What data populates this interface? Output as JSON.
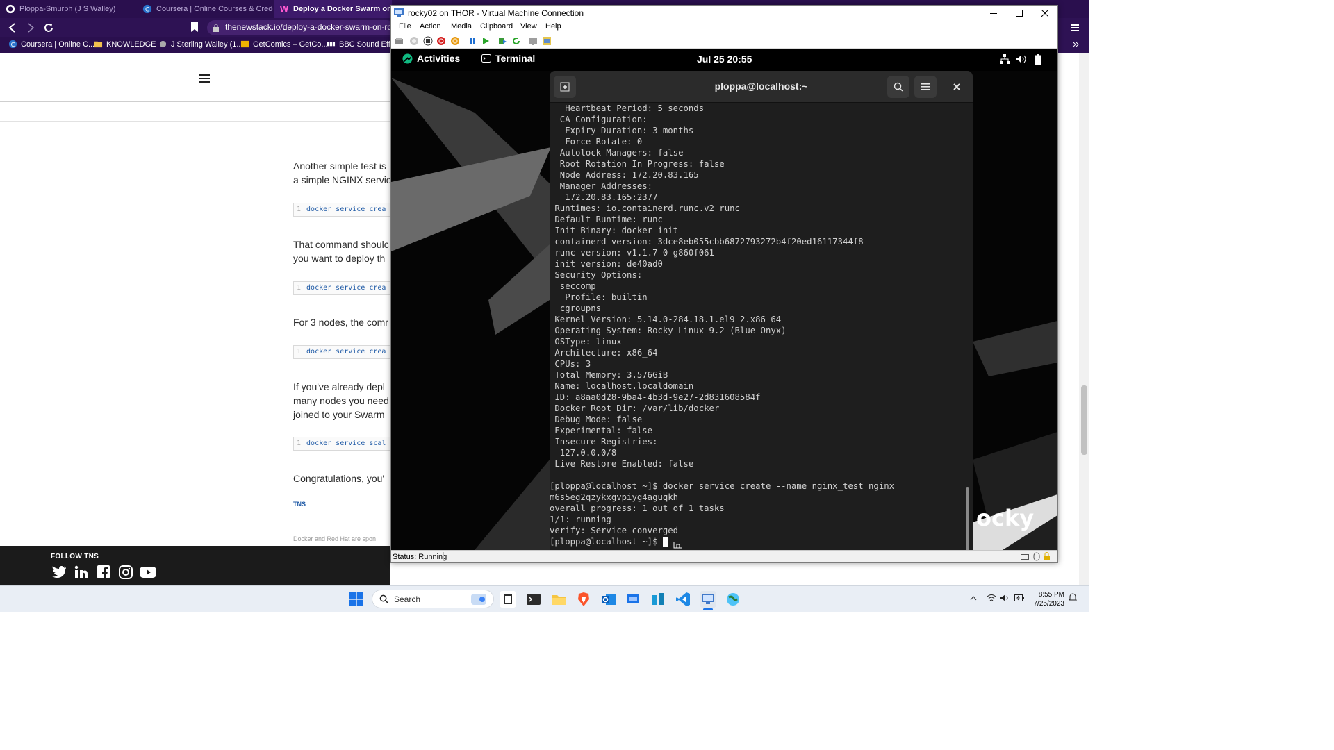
{
  "browser": {
    "tabs": [
      {
        "label": "Ploppa-Smurph (J S Walley)",
        "icon": "github-icon",
        "active": false
      },
      {
        "label": "Coursera | Online Courses & Credentia",
        "icon": "coursera-icon",
        "active": false
      },
      {
        "label": "Deploy a Docker Swarm on Roc",
        "icon": "tns-icon",
        "active": true
      }
    ],
    "url": "thenewstack.io/deploy-a-docker-swarm-on-roc",
    "bookmarks": [
      {
        "label": "Coursera | Online C...",
        "icon": "coursera-icon"
      },
      {
        "label": "KNOWLEDGE",
        "icon": "folder-icon"
      },
      {
        "label": "J Sterling Walley (1...",
        "icon": "bookmark-icon"
      },
      {
        "label": "GetComics – GetCo...",
        "icon": "comics-icon"
      },
      {
        "label": "BBC Sound Effec",
        "icon": "bbc-icon"
      }
    ]
  },
  "article": {
    "paragraphs": [
      "Another simple test is",
      "a simple NGINX servic",
      "That command shoulc",
      "you want to deploy th",
      "For 3 nodes, the comr",
      "If you've already depl",
      "many nodes you need",
      "joined to your Swarm",
      "Congratulations, you'"
    ],
    "code": [
      {
        "ln": "1",
        "text": "docker service crea"
      },
      {
        "ln": "1",
        "text": "docker service crea"
      },
      {
        "ln": "1",
        "text": "docker service crea"
      },
      {
        "ln": "1",
        "text": "docker service scal"
      }
    ],
    "tag": "TNS",
    "sponsor": "Docker and Red Hat are spon",
    "follow_label": "FOLLOW TNS"
  },
  "vm": {
    "title": "rocky02 on THOR - Virtual Machine Connection",
    "menu": [
      "File",
      "Action",
      "Media",
      "Clipboard",
      "View",
      "Help"
    ],
    "status": "Status: Running"
  },
  "gnome": {
    "activities": "Activities",
    "app": "Terminal",
    "clock": "Jul 25  20:55",
    "wallpaper_text": "ocky"
  },
  "terminal": {
    "title": "ploppa@localhost:~",
    "lines": [
      "   Heartbeat Period: 5 seconds",
      "  CA Configuration:",
      "   Expiry Duration: 3 months",
      "   Force Rotate: 0",
      "  Autolock Managers: false",
      "  Root Rotation In Progress: false",
      "  Node Address: 172.20.83.165",
      "  Manager Addresses:",
      "   172.20.83.165:2377",
      " Runtimes: io.containerd.runc.v2 runc",
      " Default Runtime: runc",
      " Init Binary: docker-init",
      " containerd version: 3dce8eb055cbb6872793272b4f20ed16117344f8",
      " runc version: v1.1.7-0-g860f061",
      " init version: de40ad0",
      " Security Options:",
      "  seccomp",
      "   Profile: builtin",
      "  cgroupns",
      " Kernel Version: 5.14.0-284.18.1.el9_2.x86_64",
      " Operating System: Rocky Linux 9.2 (Blue Onyx)",
      " OSType: linux",
      " Architecture: x86_64",
      " CPUs: 3",
      " Total Memory: 3.576GiB",
      " Name: localhost.localdomain",
      " ID: a8aa0d28-9ba4-4b3d-9e27-2d831608584f",
      " Docker Root Dir: /var/lib/docker",
      " Debug Mode: false",
      " Experimental: false",
      " Insecure Registries:",
      "  127.0.0.0/8",
      " Live Restore Enabled: false",
      "",
      "[ploppa@localhost ~]$ docker service create --name nginx_test nginx",
      "m6s5eg2qzykxgvpiyg4aguqkh",
      "overall progress: 1 out of 1 tasks",
      "1/1: running",
      "verify: Service converged",
      "[ploppa@localhost ~]$ "
    ]
  },
  "taskbar": {
    "search_placeholder": "Search",
    "time": "8:55 PM",
    "date": "7/25/2023"
  }
}
